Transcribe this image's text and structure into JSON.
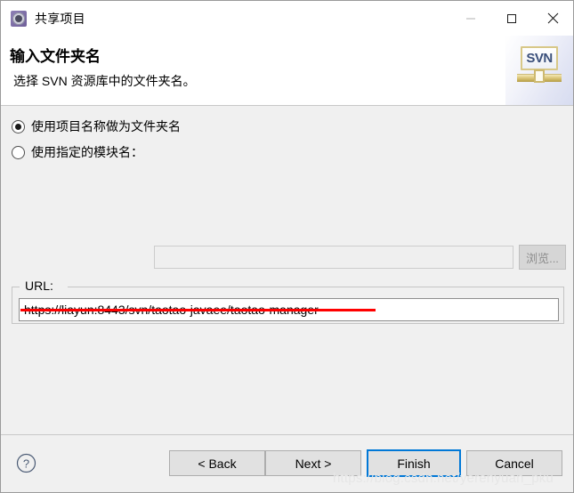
{
  "window": {
    "title": "共享项目",
    "icon": "gear-icon",
    "controls": {
      "minimize": "minimize-icon",
      "maximize": "maximize-icon",
      "close": "close-icon"
    }
  },
  "header": {
    "title": "输入文件夹名",
    "description": "选择 SVN 资源库中的文件夹名。",
    "logo_text": "SVN"
  },
  "options": {
    "use_project_name": {
      "label": "使用项目名称做为文件夹名",
      "selected": true
    },
    "use_module_name": {
      "label": "使用指定的模块名：",
      "selected": false,
      "input_value": "",
      "input_placeholder": "",
      "browse_label": "浏览...",
      "browse_enabled": false
    }
  },
  "url_group": {
    "legend": "URL:",
    "value": "https://liayun:8443/svn/taotao-javaee/taotao-manager"
  },
  "footer": {
    "help": "?",
    "buttons": {
      "back": "< Back",
      "next": "Next >",
      "finish": "Finish",
      "cancel": "Cancel"
    }
  },
  "watermark": "https://blog.csdn.net/yerenyuan_pku",
  "colors": {
    "focus_blue": "#0078d7",
    "annotation_red": "#ff0000",
    "dialog_bg": "#f0f0f0",
    "header_bg": "#ffffff"
  }
}
